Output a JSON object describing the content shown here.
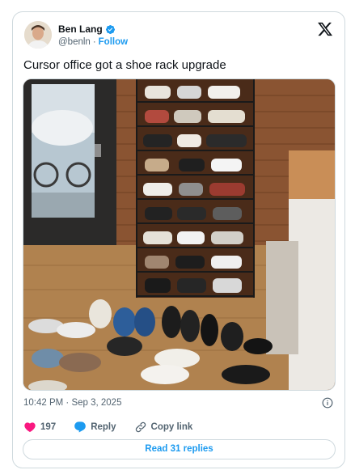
{
  "author": {
    "name": "Ben Lang",
    "handle": "@benln",
    "separator": "·",
    "follow_label": "Follow"
  },
  "tweet": {
    "text": "Cursor office got a shoe rack upgrade",
    "timestamp": "10:42 PM · Sep 3, 2025"
  },
  "actions": {
    "like_count": "197",
    "reply_label": "Reply",
    "copy_link_label": "Copy link",
    "read_replies_label": "Read 31 replies"
  },
  "colors": {
    "accent": "#1d9bf0",
    "like": "#f91880",
    "text": "#0f1419",
    "muted": "#536471",
    "border": "#cfd9de"
  },
  "icons": [
    "verified-badge-icon",
    "x-logo-icon",
    "info-icon",
    "heart-icon",
    "reply-bubble-icon",
    "link-icon"
  ]
}
